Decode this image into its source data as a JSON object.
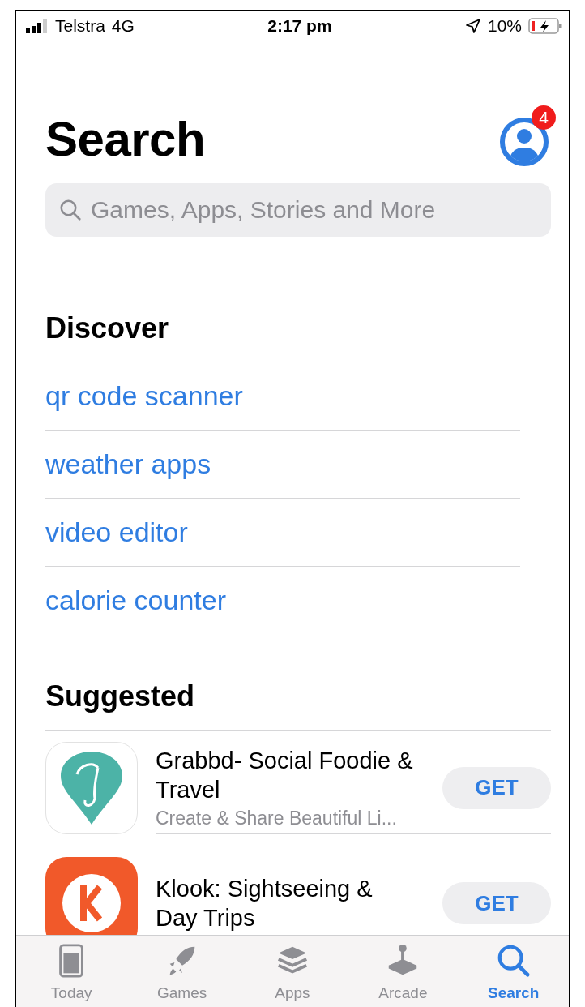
{
  "status_bar": {
    "carrier": "Telstra",
    "network": "4G",
    "time": "2:17 pm",
    "battery": "10%"
  },
  "header": {
    "title": "Search",
    "account_badge": "4"
  },
  "search": {
    "placeholder": "Games, Apps, Stories and More"
  },
  "discover": {
    "heading": "Discover",
    "items": [
      "qr code scanner",
      "weather apps",
      "video editor",
      "calorie counter"
    ]
  },
  "suggested": {
    "heading": "Suggested",
    "apps": [
      {
        "name": "Grabbd- Social Foodie & Travel",
        "subtitle": "Create & Share Beautiful Li...",
        "button": "GET",
        "kind": "grabbd"
      },
      {
        "name": "Klook: Sightseeing & Day Trips",
        "button": "GET",
        "kind": "klook"
      }
    ]
  },
  "tab_bar": [
    {
      "label": "Today",
      "selected": false,
      "kind": "today"
    },
    {
      "label": "Games",
      "selected": false,
      "kind": "games"
    },
    {
      "label": "Apps",
      "selected": false,
      "kind": "apps"
    },
    {
      "label": "Arcade",
      "selected": false,
      "kind": "arcade"
    },
    {
      "label": "Search",
      "selected": true,
      "kind": "search"
    }
  ]
}
